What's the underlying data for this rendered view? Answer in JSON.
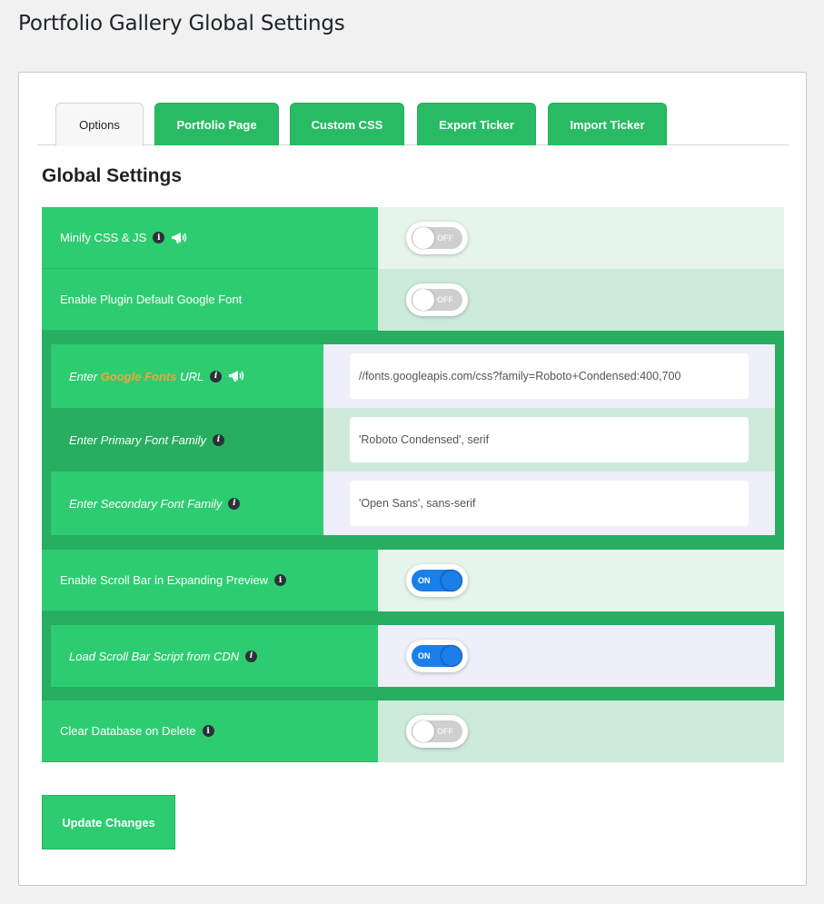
{
  "page": {
    "title": "Portfolio Gallery Global Settings"
  },
  "tabs": [
    {
      "label": "Options",
      "active": true
    },
    {
      "label": "Portfolio Page",
      "active": false
    },
    {
      "label": "Custom CSS",
      "active": false
    },
    {
      "label": "Export Ticker",
      "active": false
    },
    {
      "label": "Import Ticker",
      "active": false
    }
  ],
  "section": {
    "title": "Global Settings"
  },
  "settings": {
    "minify": {
      "label": "Minify CSS & JS",
      "state": "OFF",
      "icons": [
        "info-icon",
        "megaphone-icon"
      ]
    },
    "google_font": {
      "label": "Enable Plugin Default Google Font",
      "state": "OFF"
    },
    "font_url": {
      "label_prefix": "Enter ",
      "link_text": "Google Fonts",
      "label_suffix": " URL",
      "value": "//fonts.googleapis.com/css?family=Roboto+Condensed:400,700"
    },
    "primary_font": {
      "label": "Enter Primary Font Family",
      "value": "'Roboto Condensed', serif"
    },
    "secondary_font": {
      "label": "Enter Secondary Font Family",
      "value": "'Open Sans', sans-serif"
    },
    "scroll_bar": {
      "label": "Enable Scroll Bar in Expanding Preview",
      "state": "ON"
    },
    "scroll_cdn": {
      "label": "Load Scroll Bar Script from CDN",
      "state": "ON"
    },
    "clear_db": {
      "label": "Clear Database on Delete",
      "state": "OFF"
    }
  },
  "buttons": {
    "update": "Update Changes"
  },
  "colors": {
    "accent_green": "#2ecc71",
    "dark_green": "#27ae60",
    "toggle_on": "#1a7fe8",
    "link_orange": "#f0a53a"
  }
}
